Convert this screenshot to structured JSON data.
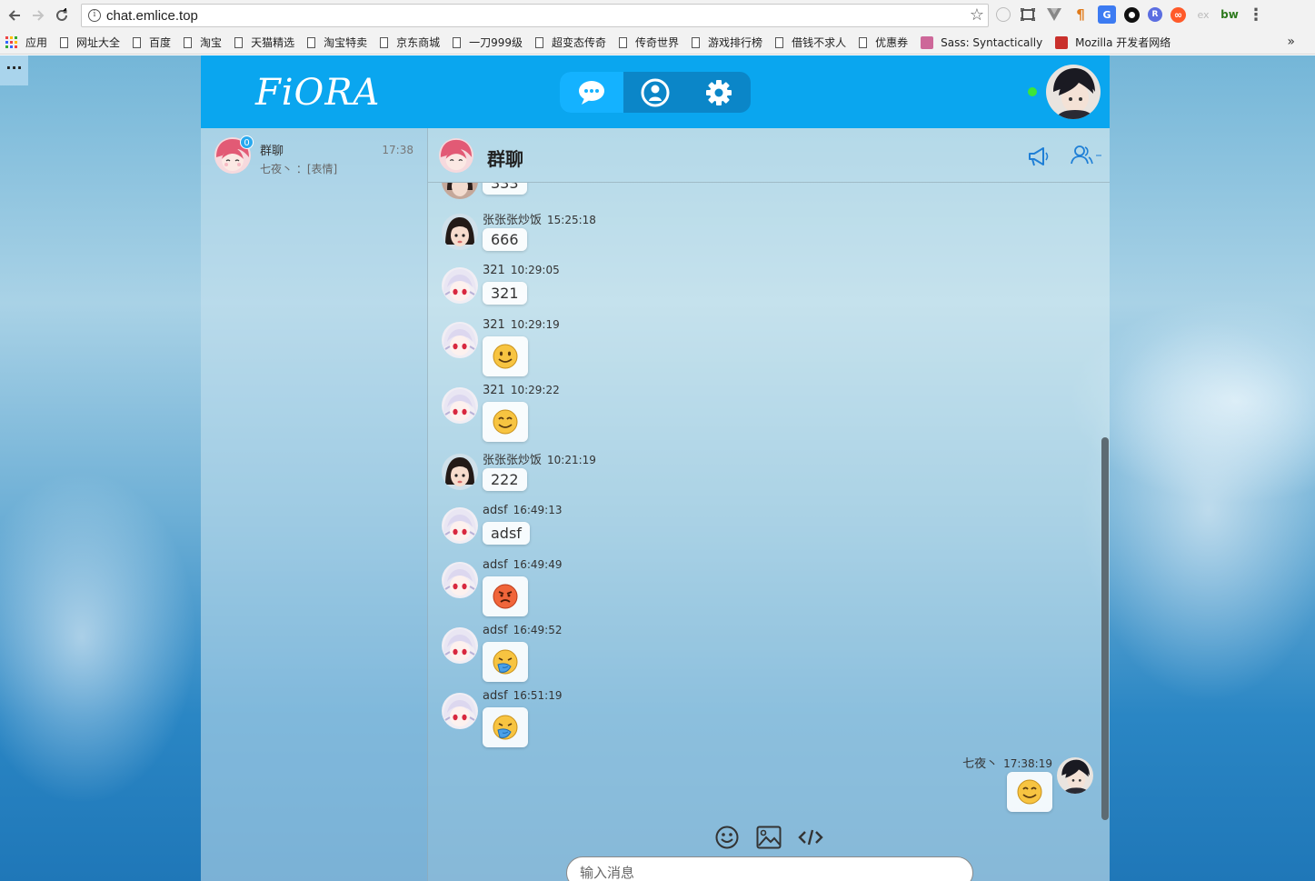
{
  "browser": {
    "url": "chat.emlice.top",
    "bookmarks": [
      "应用",
      "网址大全",
      "百度",
      "淘宝",
      "天猫精选",
      "淘宝特卖",
      "京东商城",
      "一刀999级",
      "超变态传奇",
      "传奇世界",
      "游戏排行榜",
      "借钱不求人",
      "优惠券",
      "Sass: Syntactically A",
      "Mozilla 开发者网络"
    ],
    "more_glyph": "»",
    "menu_glyph": "⋮",
    "extensions": [
      "ⓘ",
      "⛶",
      "▼",
      "¶",
      "G",
      "●",
      "R",
      "∞",
      "ex",
      "bw"
    ]
  },
  "app": {
    "logo": "FiORA",
    "header_icons": [
      "chat-bubble-icon",
      "user-icon",
      "gear-icon"
    ],
    "accent_color": "#0aa6ef",
    "online_color": "#3de53a"
  },
  "sidebar": {
    "conversation": {
      "name": "群聊",
      "time": "17:38",
      "preview": "七夜丶 ：[表情]",
      "unread": "0"
    }
  },
  "chat": {
    "title": "群聊",
    "partial_top_text": "333",
    "messages": [
      {
        "nick": "张张张炒饭",
        "time": "15:25:18",
        "text": "666",
        "avatar": "girl"
      },
      {
        "nick": "321",
        "time": "10:29:05",
        "text": "321",
        "avatar": "anime"
      },
      {
        "nick": "321",
        "time": "10:29:19",
        "emoji": "smile",
        "avatar": "anime"
      },
      {
        "nick": "321",
        "time": "10:29:22",
        "emoji": "smile-closed",
        "avatar": "anime"
      },
      {
        "nick": "张张张炒饭",
        "time": "10:21:19",
        "text": "222",
        "avatar": "girl"
      },
      {
        "nick": "adsf",
        "time": "16:49:13",
        "text": "adsf",
        "avatar": "anime"
      },
      {
        "nick": "adsf",
        "time": "16:49:49",
        "emoji": "angry",
        "avatar": "anime"
      },
      {
        "nick": "adsf",
        "time": "16:49:52",
        "emoji": "vomit",
        "avatar": "anime"
      },
      {
        "nick": "adsf",
        "time": "16:51:19",
        "emoji": "vomit",
        "avatar": "anime"
      },
      {
        "nick": "七夜丶",
        "time": "17:38:19",
        "emoji": "smile-closed",
        "avatar": "self",
        "self": true
      }
    ],
    "input_placeholder": "输入消息"
  }
}
